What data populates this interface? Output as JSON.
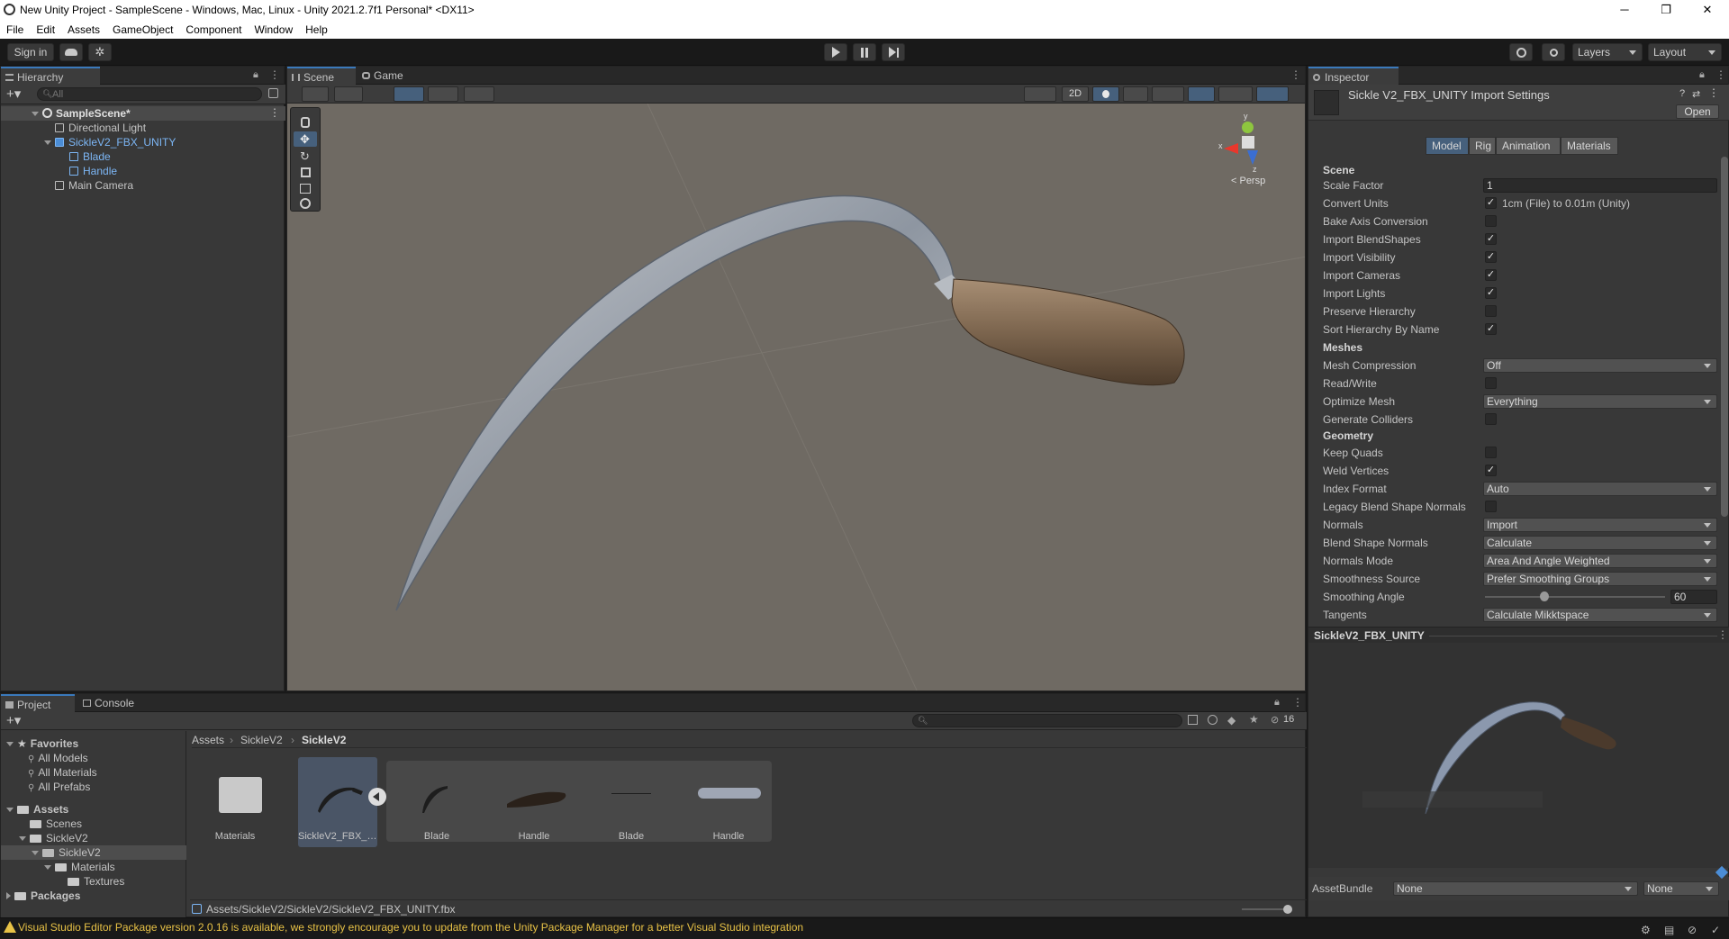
{
  "window": {
    "title": "New Unity Project - SampleScene - Windows, Mac, Linux - Unity 2021.2.7f1 Personal* <DX11>",
    "minimize": "─",
    "maximize": "❐",
    "close": "✕"
  },
  "menu": [
    "File",
    "Edit",
    "Assets",
    "GameObject",
    "Component",
    "Window",
    "Help"
  ],
  "toolbar": {
    "sign_in": "Sign in",
    "layers": "Layers",
    "layout": "Layout"
  },
  "hierarchy": {
    "tab": "Hierarchy",
    "search_placeholder": "All",
    "scene": "SampleScene*",
    "items": [
      {
        "label": "Directional Light"
      },
      {
        "label": "SickleV2_FBX_UNITY"
      },
      {
        "label": "Blade"
      },
      {
        "label": "Handle"
      },
      {
        "label": "Main Camera"
      }
    ]
  },
  "scene": {
    "tabs": [
      "Scene",
      "Game"
    ],
    "btn_2d": "2D",
    "persp": "< Persp",
    "gizmo_y": "y",
    "gizmo_z": "z",
    "gizmo_x": "x"
  },
  "inspector": {
    "tab": "Inspector",
    "title": "Sickle V2_FBX_UNITY Import Settings",
    "open": "Open",
    "tabs": [
      "Model",
      "Rig",
      "Animation",
      "Materials"
    ],
    "section_scene": "Scene",
    "section_meshes": "Meshes",
    "section_geometry": "Geometry",
    "rows": {
      "scale_factor": {
        "label": "Scale Factor",
        "value": "1"
      },
      "convert_units": {
        "label": "Convert Units",
        "value": "1cm (File) to 0.01m (Unity)",
        "checked": true
      },
      "bake_axis": {
        "label": "Bake Axis Conversion",
        "checked": false
      },
      "import_blendshapes": {
        "label": "Import BlendShapes",
        "checked": true
      },
      "import_visibility": {
        "label": "Import Visibility",
        "checked": true
      },
      "import_cameras": {
        "label": "Import Cameras",
        "checked": true
      },
      "import_lights": {
        "label": "Import Lights",
        "checked": true
      },
      "preserve_hierarchy": {
        "label": "Preserve Hierarchy",
        "checked": false
      },
      "sort_hierarchy": {
        "label": "Sort Hierarchy By Name",
        "checked": true
      },
      "mesh_compression": {
        "label": "Mesh Compression",
        "value": "Off"
      },
      "read_write": {
        "label": "Read/Write",
        "checked": false
      },
      "optimize_mesh": {
        "label": "Optimize Mesh",
        "value": "Everything"
      },
      "generate_colliders": {
        "label": "Generate Colliders",
        "checked": false
      },
      "keep_quads": {
        "label": "Keep Quads",
        "checked": false
      },
      "weld_vertices": {
        "label": "Weld Vertices",
        "checked": true
      },
      "index_format": {
        "label": "Index Format",
        "value": "Auto"
      },
      "legacy_blend": {
        "label": "Legacy Blend Shape Normals",
        "checked": false
      },
      "normals": {
        "label": "Normals",
        "value": "Import"
      },
      "blend_shape_normals": {
        "label": "Blend Shape Normals",
        "value": "Calculate"
      },
      "normals_mode": {
        "label": "Normals Mode",
        "value": "Area And Angle Weighted"
      },
      "smoothness_source": {
        "label": "Smoothness Source",
        "value": "Prefer Smoothing Groups"
      },
      "smoothing_angle": {
        "label": "Smoothing Angle",
        "value": "60",
        "fraction": 0.33
      },
      "tangents": {
        "label": "Tangents",
        "value": "Calculate Mikktspace"
      }
    },
    "preview_title": "SickleV2_FBX_UNITY",
    "assetbundle_label": "AssetBundle",
    "assetbundle_value": "None",
    "assetbundle_variant": "None"
  },
  "project": {
    "tabs": [
      "Project",
      "Console"
    ],
    "favorites": "Favorites",
    "fav_items": [
      "All Models",
      "All Materials",
      "All Prefabs"
    ],
    "assets": "Assets",
    "tree": [
      "Scenes",
      "SickleV2",
      "SickleV2",
      "Materials",
      "Textures"
    ],
    "packages": "Packages",
    "breadcrumb": [
      "Assets",
      "SickleV2",
      "SickleV2"
    ],
    "count": "16",
    "items": [
      "Materials",
      "SickleV2_FBX_UN...",
      "Blade",
      "Handle",
      "Blade",
      "Handle"
    ],
    "path": "Assets/SickleV2/SickleV2/SickleV2_FBX_UNITY.fbx"
  },
  "status": {
    "message": "Visual Studio Editor Package version 2.0.16 is available, we strongly encourage you to update from the Unity Package Manager for a better Visual Studio integration"
  }
}
